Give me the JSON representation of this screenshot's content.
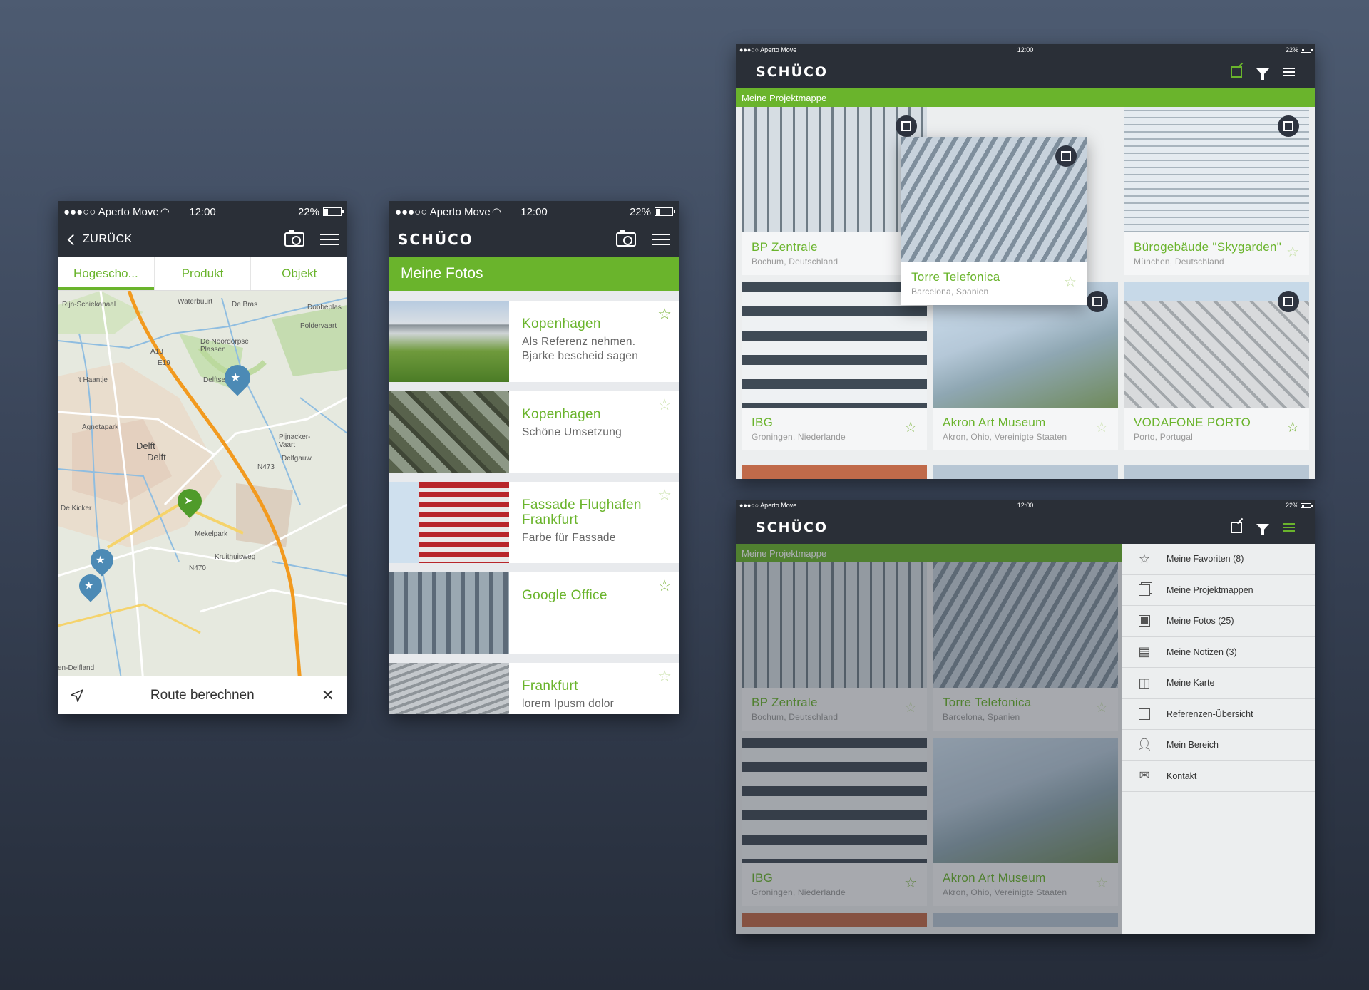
{
  "phone_status": {
    "carrier": "●●●○○ Aperto Move",
    "time": "12:00",
    "battery": "22%"
  },
  "map_screen": {
    "back_label": "ZURÜCK",
    "tabs": [
      "Hogescho...",
      "Produkt",
      "Objekt"
    ],
    "route_label": "Route berechnen",
    "labels": {
      "delft": "Delft",
      "delft2": "Delft",
      "agnetapark": "Agnetapark",
      "mekelpark": "Mekelpark",
      "rijn": "Rijn-Schiekanaal",
      "haantje": "'t Haantje",
      "waterbuurt": "Waterbuurt",
      "debras": "De Bras",
      "noordorpse": "De Noordorpse Plassen",
      "dobbe": "Dobbeplas",
      "polder": "Poldervaart",
      "delftse": "Delftse",
      "kicker": "De Kicker",
      "delfgauw": "Delfgauw",
      "delfland": "en-Delfland",
      "kruithuisweg": "Kruithuisweg",
      "pijnacker": "Pijnacker-Vaart",
      "n470": "N470",
      "a13": "A13",
      "e19": "E19",
      "n473": "N473"
    }
  },
  "photos_screen": {
    "title": "Meine Fotos",
    "items": [
      {
        "title": "Kopenhagen",
        "sub": "Als Referenz nehmen. Bjarke bescheid sagen"
      },
      {
        "title": "Kopenhagen",
        "sub": "Schöne Umsetzung"
      },
      {
        "title": "Fassade Flughafen Frankfurt",
        "sub": "Farbe für Fassade"
      },
      {
        "title": "Google Office",
        "sub": ""
      },
      {
        "title": "Frankfurt",
        "sub": "lorem Ipusm dolor"
      }
    ]
  },
  "logo": "SCHÜCO",
  "tablet_status": {
    "carrier": "●●●○○ Aperto Move",
    "time": "12:00",
    "battery": "22%"
  },
  "tablet_top": {
    "section": "Meine Projektmappe",
    "cards": [
      {
        "title": "BP Zentrale",
        "sub": "Bochum, Deutschland"
      },
      {
        "title": "Torre Telefonica",
        "sub": "Barcelona, Spanien"
      },
      {
        "title": "Bürogebäude \"Skygarden\"",
        "sub": "München, Deutschland"
      },
      {
        "title": "IBG",
        "sub": "Groningen, Niederlande"
      },
      {
        "title": "Akron Art Museum",
        "sub": "Akron, Ohio, Vereinigte Staaten"
      },
      {
        "title": "VODAFONE PORTO",
        "sub": "Porto, Portugal"
      }
    ]
  },
  "tablet_bottom": {
    "section": "Meine Projektmappe",
    "cards": [
      {
        "title": "BP Zentrale",
        "sub": "Bochum, Deutschland"
      },
      {
        "title": "Torre Telefonica",
        "sub": "Barcelona, Spanien"
      },
      {
        "title": "IBG",
        "sub": "Groningen, Niederlande"
      },
      {
        "title": "Akron Art Museum",
        "sub": "Akron, Ohio, Vereinigte Staaten"
      }
    ],
    "menu": [
      "Meine Favoriten (8)",
      "Meine Projektmappen",
      "Meine Fotos (25)",
      "Meine Notizen (3)",
      "Meine Karte",
      "Referenzen-Übersicht",
      "Mein Bereich",
      "Kontakt"
    ]
  },
  "colors": {
    "accent": "#6ab42c",
    "header": "#2a2f37",
    "background": "#3a4559"
  }
}
